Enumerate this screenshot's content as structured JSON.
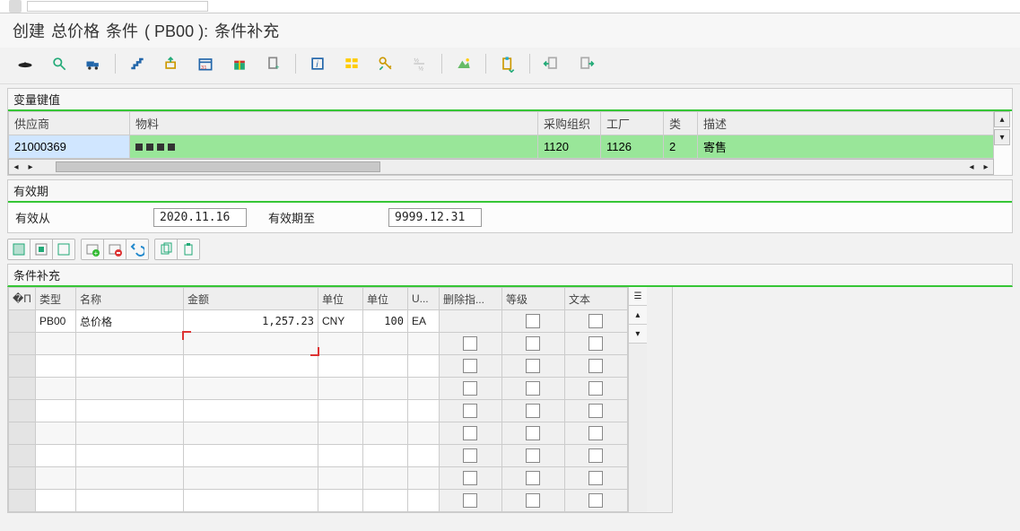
{
  "title": {
    "t1": "创建",
    "t2": "总价格",
    "t3": "条件",
    "t4": "( PB00 ):",
    "t5": "条件补充"
  },
  "panels": {
    "variable_key": "变量键值",
    "validity": "有效期",
    "condition": "条件补充"
  },
  "vk": {
    "headers": {
      "vendor": "供应商",
      "material": "物料",
      "purch_org": "采购组织",
      "plant": "工厂",
      "cat": "类",
      "desc": "描述"
    },
    "row": {
      "vendor": "21000369",
      "material_masked": true,
      "purch_org": "1120",
      "plant": "1126",
      "cat": "2",
      "desc": "寄售"
    }
  },
  "validity": {
    "from_label": "有效从",
    "from_value": "2020.11.16",
    "to_label": "有效期至",
    "to_value": "9999.12.31"
  },
  "grid": {
    "headers": {
      "sel": "�П",
      "type": "类型",
      "name": "名称",
      "amount": "金额",
      "unit1": "单位",
      "unit2": "单位",
      "u": "U...",
      "del": "删除指...",
      "scale": "等级",
      "text": "文本",
      "cfg": "☰"
    },
    "rows": [
      {
        "type": "PB00",
        "name": "总价格",
        "amount": "1,257.23",
        "unit1": "CNY",
        "unit2": "100",
        "u": "EA",
        "del": false,
        "scale": false,
        "text": false
      },
      {
        "type": "",
        "name": "",
        "amount": "",
        "unit1": "",
        "unit2": "",
        "u": "",
        "del": false,
        "scale": false,
        "text": false,
        "focus": true
      },
      {
        "type": "",
        "name": "",
        "amount": "",
        "unit1": "",
        "unit2": "",
        "u": "",
        "del": false,
        "scale": false,
        "text": false
      },
      {
        "type": "",
        "name": "",
        "amount": "",
        "unit1": "",
        "unit2": "",
        "u": "",
        "del": false,
        "scale": false,
        "text": false
      },
      {
        "type": "",
        "name": "",
        "amount": "",
        "unit1": "",
        "unit2": "",
        "u": "",
        "del": false,
        "scale": false,
        "text": false
      },
      {
        "type": "",
        "name": "",
        "amount": "",
        "unit1": "",
        "unit2": "",
        "u": "",
        "del": false,
        "scale": false,
        "text": false
      },
      {
        "type": "",
        "name": "",
        "amount": "",
        "unit1": "",
        "unit2": "",
        "u": "",
        "del": false,
        "scale": false,
        "text": false
      },
      {
        "type": "",
        "name": "",
        "amount": "",
        "unit1": "",
        "unit2": "",
        "u": "",
        "del": false,
        "scale": false,
        "text": false
      },
      {
        "type": "",
        "name": "",
        "amount": "",
        "unit1": "",
        "unit2": "",
        "u": "",
        "del": false,
        "scale": false,
        "text": false
      }
    ]
  },
  "colors": {
    "accent": "#36c636"
  }
}
